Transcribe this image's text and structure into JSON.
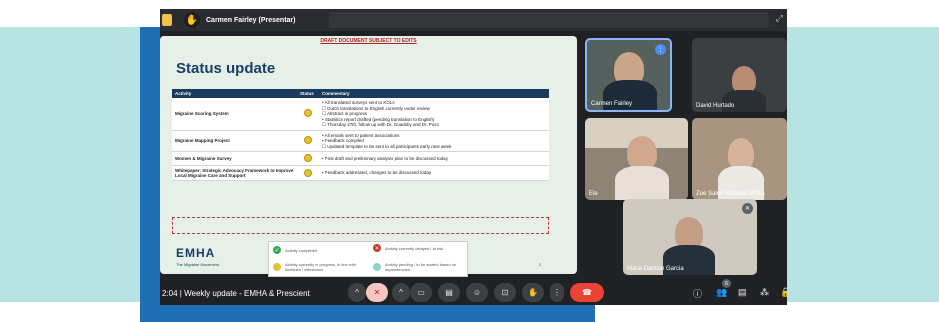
{
  "topbar": {
    "presenter": "Carmen Fairley (Presentar)"
  },
  "slide": {
    "draft_notice": "DRAFT DOCUMENT SUBJECT TO EDITS",
    "title": "Status update",
    "columns": [
      "Activity",
      "Status",
      "Commentary"
    ],
    "rows": [
      {
        "activity": "Migraine Scoring System",
        "comments": [
          "All translated surveys sent to KOLs",
          "Dutch translations to English currently under review",
          "Abstract in progress",
          "Statistics report drafted (pending translation to English)",
          "Thursday 27th, follow up with Dr, Goadsby and Dr, Pozo"
        ]
      },
      {
        "activity": "Migraine Mapping Project",
        "comments": [
          "All emails sent to patient associations",
          "Feedback compiled",
          "Updated template to be sent to all participants early next week"
        ]
      },
      {
        "activity": "Women & Migraine Survey",
        "comments": [
          "First draft and preliminary analysis plan to be discussed today"
        ]
      },
      {
        "activity": "Whitepaper: Strategic Advocacy Framework to Improve Local Migraine Care and Support",
        "comments": [
          "Feedback addressed, changes to be discussed today"
        ]
      }
    ],
    "legend": {
      "completed": "Activity completed",
      "delayed": "Activity currently delayed / at risk",
      "in_progress": "Activity currently in progress, in line with timelines / milestones",
      "pending": "Activity pending / to be started based on dependencies"
    },
    "brand": "EMHA",
    "brand_sub": "The Migraine Movement",
    "page_number": "2"
  },
  "participants": [
    {
      "name": "Carmen Fairley"
    },
    {
      "name": "David Hurtado"
    },
    {
      "name": "Ele"
    },
    {
      "name": "Zoe Sales Rolando MFAA"
    },
    {
      "name": "Maria Damian Garcia"
    }
  ],
  "controls": {
    "meeting_label": "2:04  |  Weekly update - EMHA & Prescient",
    "people_badge": "6"
  },
  "colors": {
    "status_yellow": "#e6c232",
    "leave_red": "#ea4335",
    "slide_bg": "#e6efe8",
    "header_navy": "#1a3a5e"
  }
}
